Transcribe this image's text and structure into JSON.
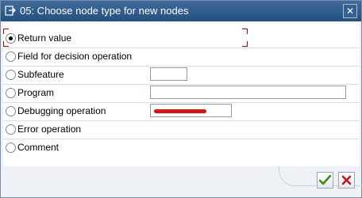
{
  "window": {
    "title": "05: Choose node type for new nodes",
    "close_label": "✕"
  },
  "options": [
    {
      "label": "Return value",
      "checked": true
    },
    {
      "label": "Field for decision operation",
      "checked": false
    },
    {
      "label": "Subfeature",
      "checked": false
    },
    {
      "label": "Program",
      "checked": false
    },
    {
      "label": "Debugging operation",
      "checked": false
    },
    {
      "label": "Error operation",
      "checked": false
    },
    {
      "label": "Comment",
      "checked": false
    }
  ],
  "fields": {
    "subfeature_value": "",
    "program_value": "",
    "debugging_value": ""
  },
  "buttons": {
    "ok_icon": "checkmark-icon",
    "cancel_icon": "cross-icon"
  },
  "colors": {
    "titlebar": "#2f5d8d",
    "focus_marker": "#c00000",
    "ok_icon": "#3a8a1f",
    "cancel_icon": "#c01818"
  }
}
